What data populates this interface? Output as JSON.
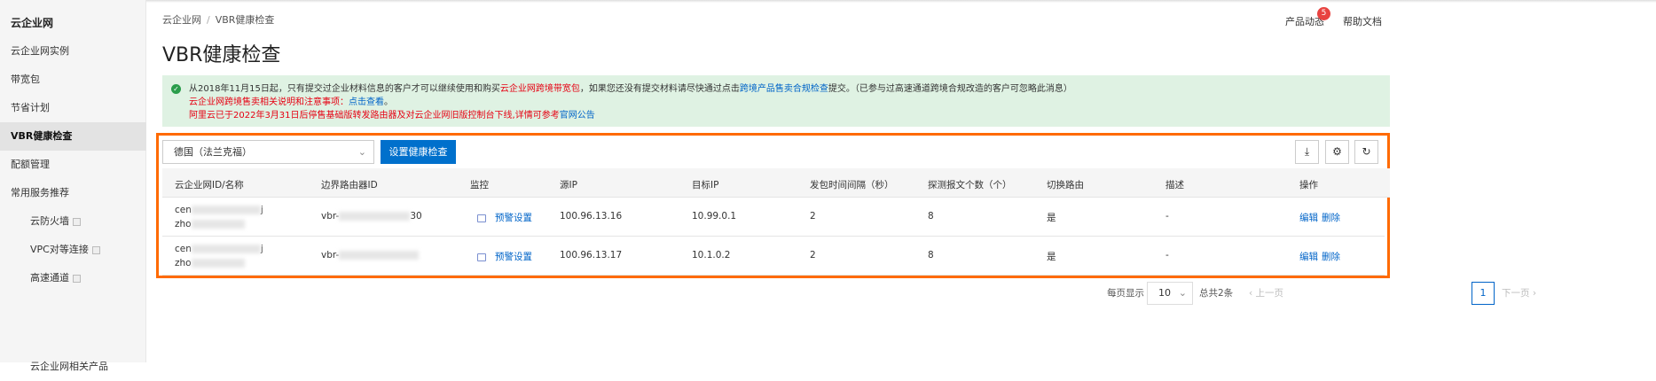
{
  "sidebar": {
    "title": "云企业网",
    "items": [
      {
        "label": "云企业网实例"
      },
      {
        "label": "带宽包"
      },
      {
        "label": "节省计划"
      },
      {
        "label": "VBR健康检查",
        "active": true
      },
      {
        "label": "配额管理"
      },
      {
        "label": "常用服务推荐"
      },
      {
        "label": "云防火墙",
        "external": true
      },
      {
        "label": "VPC对等连接",
        "external": true
      },
      {
        "label": "高速通道",
        "external": true
      },
      {
        "label": "云企业网相关产品"
      }
    ]
  },
  "breadcrumb": {
    "root": "云企业网",
    "sep": "/",
    "current": "VBR健康检查"
  },
  "header": {
    "product_news": "产品动态",
    "news_badge": "5",
    "help": "帮助文档"
  },
  "page_title": "VBR健康检查",
  "alert": {
    "line1_a": "从2018年11月15日起，只有提交过企业材料信息的客户才可以继续使用和购买",
    "line1_red": "云企业网跨境带宽包",
    "line1_b": "，如果您还没有提交材料请尽快通过点击",
    "line1_link": "跨境产品售卖合规检查",
    "line1_c": "提交。（已参与过高速通道跨境合规改造的客户可忽略此消息）",
    "line2_red": "云企业网跨境售卖相关说明和注意事项：",
    "line2_link": "点击查看",
    "line2_end": "。",
    "line3_red": "阿里云已于2022年3月31日后停售基础版转发路由器及对云企业网旧版控制台下线,详情可参考",
    "line3_link": "官网公告"
  },
  "toolbar": {
    "region": "德国（法兰克福）",
    "setup_button": "设置健康检查"
  },
  "table": {
    "headers": [
      "云企业网ID/名称",
      "边界路由器ID",
      "监控",
      "源IP",
      "目标IP",
      "发包时间间隔（秒）",
      "探测报文个数（个）",
      "切换路由",
      "描述",
      "操作"
    ],
    "rows": [
      {
        "cen_prefix": "cen",
        "cen_suffix": "j",
        "name_prefix": "zho",
        "vbr_prefix": "vbr-",
        "vbr_suffix": "30",
        "monitor": "预警设置",
        "src_ip": "100.96.13.16",
        "dst_ip": "10.99.0.1",
        "interval": "2",
        "count": "8",
        "switch": "是",
        "desc": "-",
        "edit": "编辑",
        "delete": "删除"
      },
      {
        "cen_prefix": "cen",
        "cen_suffix": "j",
        "name_prefix": "zho",
        "vbr_prefix": "vbr-",
        "vbr_suffix": "",
        "monitor": "预警设置",
        "src_ip": "100.96.13.17",
        "dst_ip": "10.1.0.2",
        "interval": "2",
        "count": "8",
        "switch": "是",
        "desc": "-",
        "edit": "编辑",
        "delete": "删除"
      }
    ]
  },
  "pagination": {
    "per_page_label": "每页显示",
    "per_page": "10",
    "total": "总共2条",
    "prev": "上一页",
    "page": "1",
    "next": "下一页"
  }
}
